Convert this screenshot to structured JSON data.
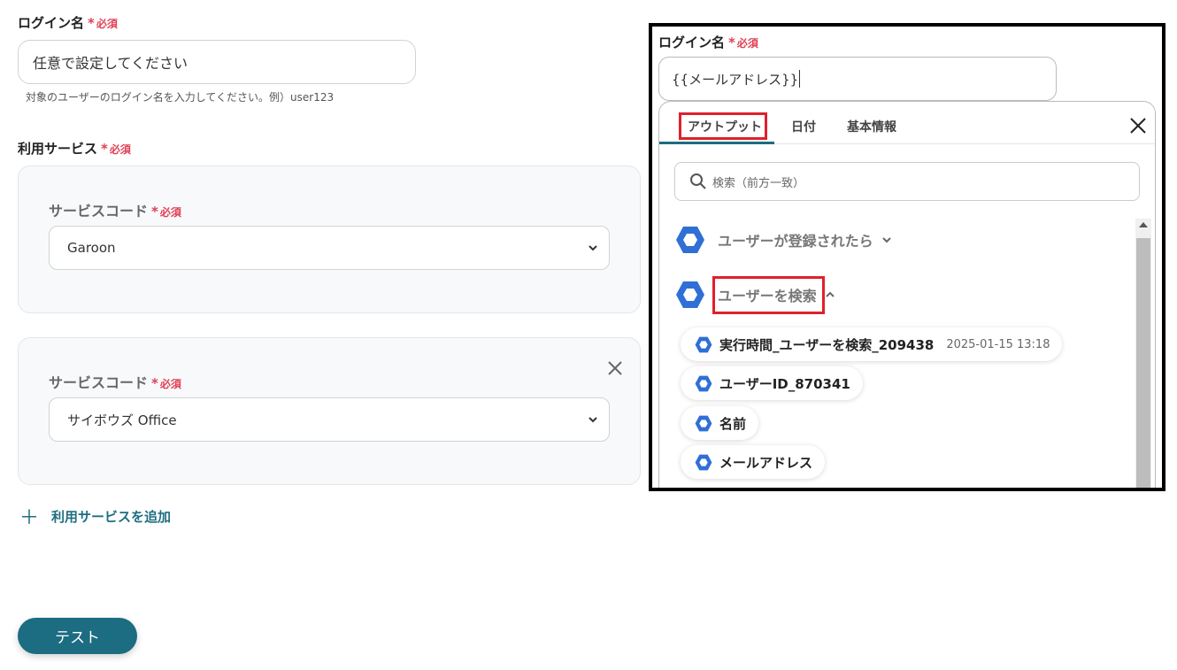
{
  "required_text": "必須",
  "required_asterisk": "*",
  "login": {
    "label": "ログイン名",
    "placeholder": "任意で設定してください",
    "hint": "対象のユーザーのログイン名を入力してください。例）user123"
  },
  "services": {
    "label": "利用サービス",
    "cards": [
      {
        "label": "サービスコード",
        "value": "Garoon"
      },
      {
        "label": "サービスコード",
        "value": "サイボウズ Office"
      }
    ],
    "add_label": "利用サービスを追加"
  },
  "test_button": "テスト",
  "overlay": {
    "label": "ログイン名",
    "input_value": "{{メールアドレス}}",
    "tabs": [
      "アウトプット",
      "日付",
      "基本情報"
    ],
    "active_tab": "アウトプット",
    "search_placeholder": "検索（前方一致）",
    "groups": [
      {
        "label": "ユーザーが登録されたら",
        "expanded": false
      },
      {
        "label": "ユーザーを検索",
        "expanded": true
      }
    ],
    "items": [
      {
        "label": "実行時間_ユーザーを検索_209438",
        "timestamp": "2025-01-15 13:18"
      },
      {
        "label": "ユーザーID_870341"
      },
      {
        "label": "名前"
      },
      {
        "label": "メールアドレス"
      }
    ]
  },
  "colors": {
    "accent": "#1c6c82",
    "required": "#e04055",
    "highlight": "#e0202a",
    "app_icon": "#2f6fd6"
  },
  "icons": [
    "chevron-down-icon",
    "close-icon",
    "search-icon",
    "chevron-up-icon",
    "hexagon-app-icon",
    "plus-icon"
  ]
}
